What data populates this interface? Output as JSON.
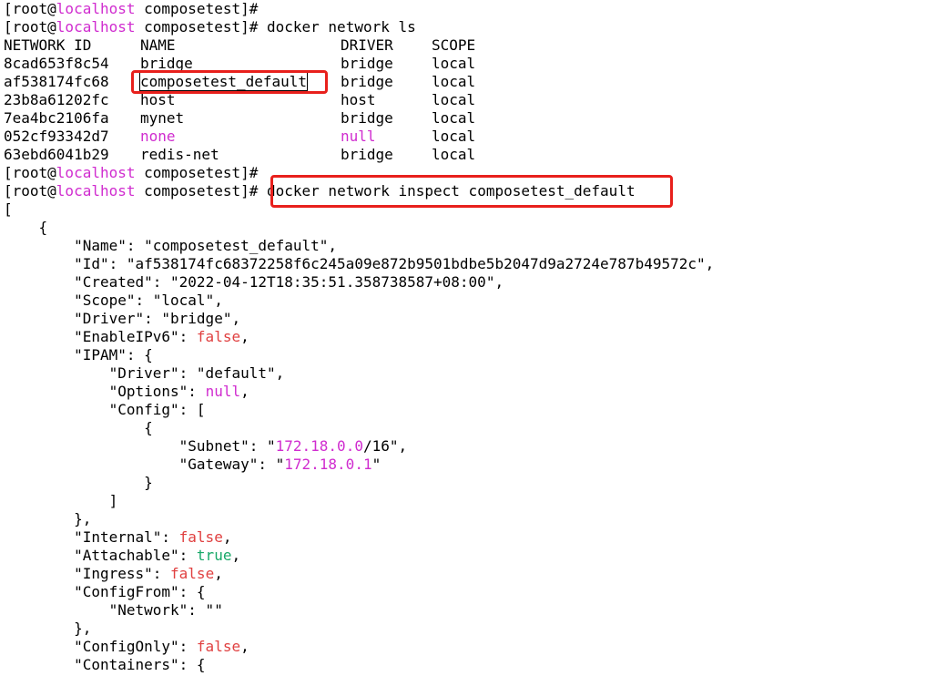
{
  "colors": {
    "text": "#000000",
    "host": "#d02ccf",
    "keyword_false": "#e04040",
    "keyword_true": "#18a868",
    "number": "#d02ccf",
    "highlight": "#e8201c"
  },
  "prompt": {
    "open": "[root@",
    "host": "localhost",
    "rest": " composetest]#"
  },
  "commands": {
    "ls": " docker network ls",
    "inspect": "docker network inspect composetest_default"
  },
  "table": {
    "headers": [
      "NETWORK ID",
      "NAME",
      "DRIVER",
      "SCOPE"
    ],
    "rows": [
      {
        "id": "8cad653f8c54",
        "name": "bridge",
        "driver": "bridge",
        "scope": "local"
      },
      {
        "id": "af538174fc68",
        "name": "composetest_default",
        "driver": "bridge",
        "scope": "local"
      },
      {
        "id": "23b8a61202fc",
        "name": "host",
        "driver": "host",
        "scope": "local"
      },
      {
        "id": "7ea4bc2106fa",
        "name": "mynet",
        "driver": "bridge",
        "scope": "local"
      },
      {
        "id": "052cf93342d7",
        "name": "none",
        "driver": "null",
        "scope": "local"
      },
      {
        "id": "63ebd6041b29",
        "name": "redis-net",
        "driver": "bridge",
        "scope": "local"
      }
    ]
  },
  "inspect": {
    "open_bracket": "[",
    "open_brace": "    {",
    "name_key": "        \"Name\": ",
    "name_val": "\"composetest_default\",",
    "id_key": "        \"Id\": ",
    "id_val": "\"af538174fc68372258f6c245a09e872b9501bdbe5b2047d9a2724e787b49572c\",",
    "created_key": "        \"Created\": ",
    "created_val": "\"2022-04-12T18:35:51.358738587+08:00\",",
    "scope_key": "        \"Scope\": ",
    "scope_val": "\"local\",",
    "driver_key": "        \"Driver\": ",
    "driver_val": "\"bridge\",",
    "ipv6_key": "        \"EnableIPv6\": ",
    "ipv6_val": "false",
    "ipam_key": "        \"IPAM\": {",
    "ipam_driver_key": "            \"Driver\": ",
    "ipam_driver_val": "\"default\",",
    "options_key": "            \"Options\": ",
    "options_val": "null",
    "config_key": "            \"Config\": [",
    "cfg_open": "                {",
    "subnet_key": "                    \"Subnet\": \"",
    "subnet_ip": "172.18.0.0",
    "subnet_rest": "/16\",",
    "gateway_key": "                    \"Gateway\": \"",
    "gateway_ip": "172.18.0.1",
    "gateway_rest": "\"",
    "cfg_close": "                }",
    "config_close": "            ]",
    "ipam_close": "        },",
    "internal_key": "        \"Internal\": ",
    "internal_val": "false",
    "attachable_key": "        \"Attachable\": ",
    "attachable_val": "true",
    "ingress_key": "        \"Ingress\": ",
    "ingress_val": "false",
    "configfrom_key": "        \"ConfigFrom\": {",
    "network_key": "            \"Network\": \"\"",
    "configfrom_close": "        },",
    "configonly_key": "        \"ConfigOnly\": ",
    "configonly_val": "false",
    "containers_key": "        \"Containers\": {"
  }
}
